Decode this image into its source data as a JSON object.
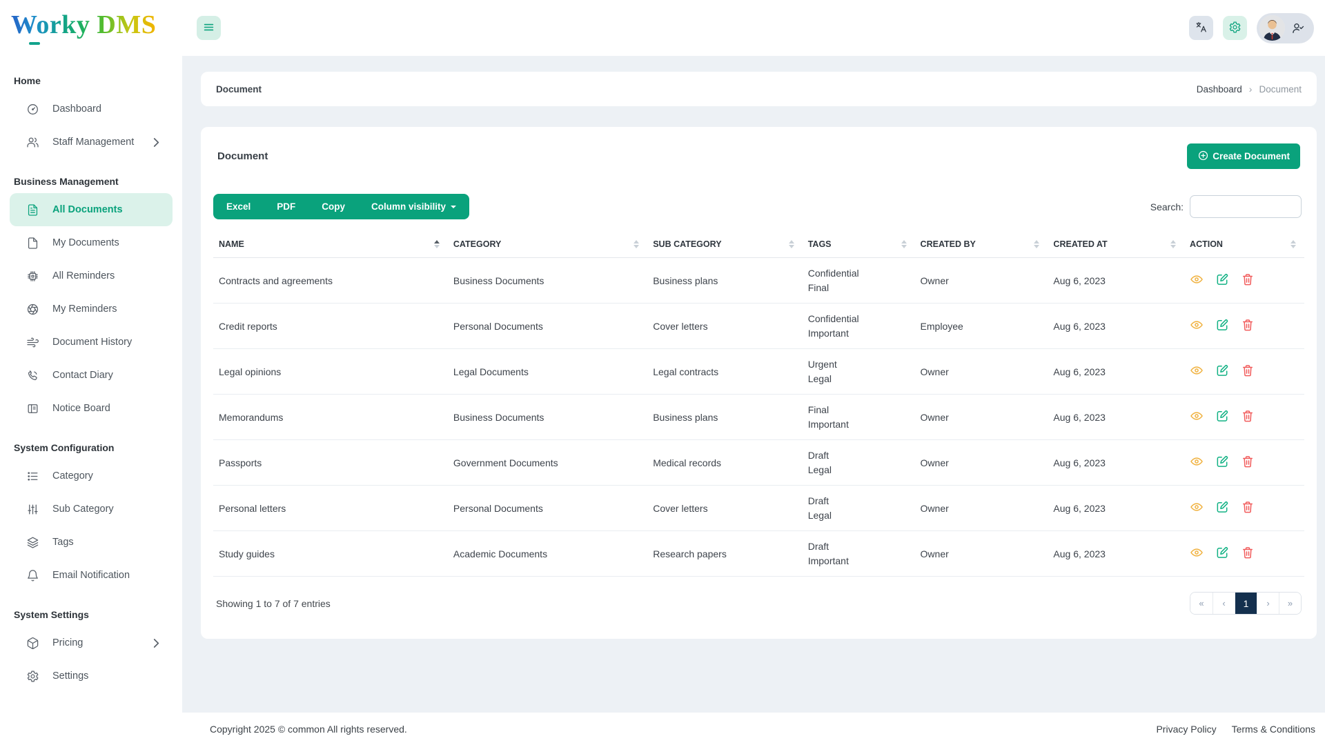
{
  "logo": {
    "text": "Worky DMS"
  },
  "topbar": {
    "icons": [
      "hamburger-icon",
      "translate-icon",
      "gear-icon",
      "avatar",
      "person-check-icon"
    ]
  },
  "sidebar": {
    "sections": [
      {
        "title": "Home",
        "items": [
          {
            "icon": "gauge-icon",
            "label": "Dashboard"
          },
          {
            "icon": "users-icon",
            "label": "Staff Management",
            "chevron": true
          }
        ]
      },
      {
        "title": "Business Management",
        "items": [
          {
            "icon": "file-text-icon",
            "label": "All Documents",
            "active": true
          },
          {
            "icon": "file-icon",
            "label": "My Documents"
          },
          {
            "icon": "chip-icon",
            "label": "All Reminders"
          },
          {
            "icon": "aperture-icon",
            "label": "My Reminders"
          },
          {
            "icon": "wind-icon",
            "label": "Document History"
          },
          {
            "icon": "phone-icon",
            "label": "Contact Diary"
          },
          {
            "icon": "board-icon",
            "label": "Notice Board"
          }
        ]
      },
      {
        "title": "System Configuration",
        "items": [
          {
            "icon": "list-icon",
            "label": "Category"
          },
          {
            "icon": "sliders-icon",
            "label": "Sub Category"
          },
          {
            "icon": "layers-icon",
            "label": "Tags"
          },
          {
            "icon": "bell-icon",
            "label": "Email Notification"
          }
        ]
      },
      {
        "title": "System Settings",
        "items": [
          {
            "icon": "box-icon",
            "label": "Pricing",
            "chevron": true
          },
          {
            "icon": "gear-icon",
            "label": "Settings"
          }
        ]
      }
    ]
  },
  "breadcrumb": {
    "title": "Document",
    "items": [
      "Dashboard",
      "Document"
    ],
    "separator": "›"
  },
  "page": {
    "card_title": "Document",
    "create_button": "Create Document"
  },
  "toolbar": {
    "buttons": [
      "Excel",
      "PDF",
      "Copy"
    ],
    "column_visibility": "Column visibility",
    "search_label": "Search:",
    "search_value": ""
  },
  "table": {
    "columns": [
      {
        "label": "NAME",
        "sorted": "asc"
      },
      {
        "label": "CATEGORY",
        "sorted": null
      },
      {
        "label": "SUB CATEGORY",
        "sorted": null
      },
      {
        "label": "TAGS",
        "sorted": null
      },
      {
        "label": "CREATED BY",
        "sorted": null
      },
      {
        "label": "CREATED AT",
        "sorted": null
      },
      {
        "label": "ACTION",
        "sorted": null
      }
    ],
    "rows": [
      {
        "name": "Contracts and agreements",
        "category": "Business Documents",
        "sub_category": "Business plans",
        "tags": [
          "Confidential",
          "Final"
        ],
        "created_by": "Owner",
        "created_at": "Aug 6, 2023"
      },
      {
        "name": "Credit reports",
        "category": "Personal Documents",
        "sub_category": "Cover letters",
        "tags": [
          "Confidential",
          "Important"
        ],
        "created_by": "Employee",
        "created_at": "Aug 6, 2023"
      },
      {
        "name": "Legal opinions",
        "category": "Legal Documents",
        "sub_category": "Legal contracts",
        "tags": [
          "Urgent",
          "Legal"
        ],
        "created_by": "Owner",
        "created_at": "Aug 6, 2023"
      },
      {
        "name": "Memorandums",
        "category": "Business Documents",
        "sub_category": "Business plans",
        "tags": [
          "Final",
          "Important"
        ],
        "created_by": "Owner",
        "created_at": "Aug 6, 2023"
      },
      {
        "name": "Passports",
        "category": "Government Documents",
        "sub_category": "Medical records",
        "tags": [
          "Draft",
          "Legal"
        ],
        "created_by": "Owner",
        "created_at": "Aug 6, 2023"
      },
      {
        "name": "Personal letters",
        "category": "Personal Documents",
        "sub_category": "Cover letters",
        "tags": [
          "Draft",
          "Legal"
        ],
        "created_by": "Owner",
        "created_at": "Aug 6, 2023"
      },
      {
        "name": "Study guides",
        "category": "Academic Documents",
        "sub_category": "Research papers",
        "tags": [
          "Draft",
          "Important"
        ],
        "created_by": "Owner",
        "created_at": "Aug 6, 2023"
      }
    ],
    "action_icons": [
      "eye-icon",
      "edit-icon",
      "trash-icon"
    ]
  },
  "table_footer": {
    "showing": "Showing 1 to 7 of 7 entries",
    "pagination": [
      "«",
      "‹",
      "1",
      "›",
      "»"
    ],
    "active_index": 2
  },
  "footer": {
    "copyright": "Copyright 2025 © common All rights reserved.",
    "links": [
      "Privacy Policy",
      "Terms & Conditions"
    ]
  },
  "colors": {
    "accent": "#0aa27c",
    "accent_light": "#dbf2ea",
    "content_background": "#edf1f5",
    "pagination_active": "#14304e",
    "view_icon": "#f0b13e",
    "edit_icon": "#10b183",
    "delete_icon": "#f15b5b"
  }
}
